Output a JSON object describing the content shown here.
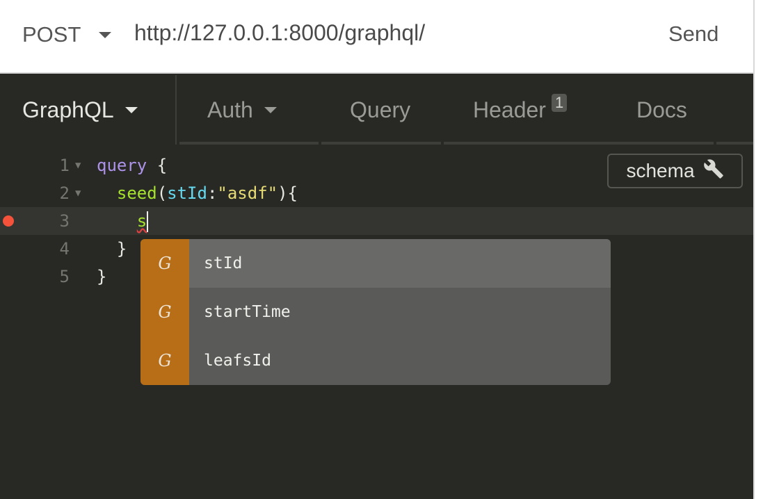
{
  "request": {
    "method": "POST",
    "url": "http://127.0.0.1:8000/graphql/",
    "send_label": "Send"
  },
  "tabs": [
    {
      "label": "GraphQL",
      "active": true,
      "has_dropdown": true
    },
    {
      "label": "Auth",
      "active": false,
      "has_dropdown": true
    },
    {
      "label": "Query",
      "active": false
    },
    {
      "label": "Header",
      "active": false,
      "badge": "1"
    },
    {
      "label": "Docs",
      "active": false
    }
  ],
  "editor": {
    "line_numbers": [
      "1",
      "2",
      "3",
      "4",
      "5"
    ],
    "lines": {
      "l1": {
        "keyword": "query",
        "brace": " {"
      },
      "l2": {
        "field": "seed",
        "open": "(",
        "arg": "stId",
        "colon": ":",
        "string": "\"asdf\"",
        "close": "){"
      },
      "l3": {
        "typed": "s"
      },
      "l4": {
        "text": "}"
      },
      "l5": {
        "text": "}"
      }
    },
    "error_line": "3",
    "schema_button": "schema"
  },
  "autocomplete": {
    "type_icon": "G",
    "items": [
      {
        "label": "stId",
        "selected": true
      },
      {
        "label": "startTime",
        "selected": false
      },
      {
        "label": "leafsId",
        "selected": false
      }
    ]
  },
  "colors": {
    "accent_orange": "#b86e17",
    "error_red": "#f4523b",
    "editor_bg": "#282925"
  }
}
